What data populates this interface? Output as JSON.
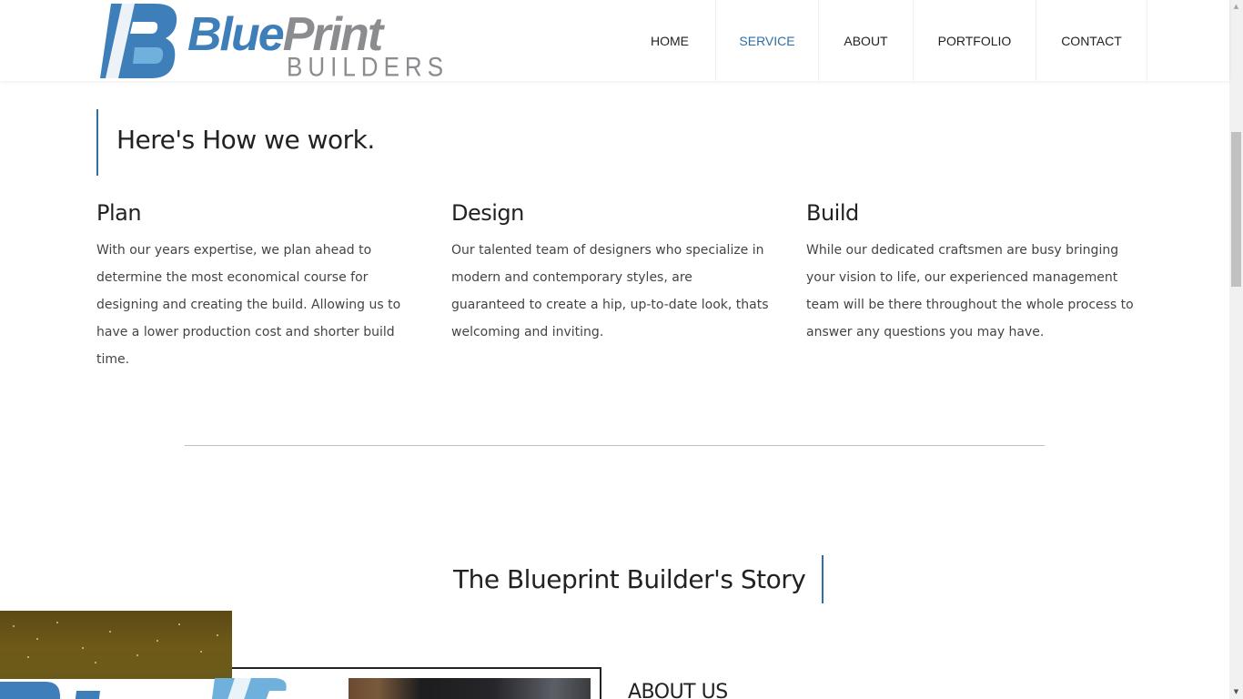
{
  "header": {
    "logo": {
      "word_blue": "Blue",
      "word_grey": "Print",
      "sub": "BUILDERS"
    },
    "nav": [
      {
        "label": "HOME",
        "active": false
      },
      {
        "label": "SERVICE",
        "active": true
      },
      {
        "label": "ABOUT",
        "active": false
      },
      {
        "label": "PORTFOLIO",
        "active": false
      },
      {
        "label": "CONTACT",
        "active": false
      }
    ]
  },
  "how": {
    "heading": "Here's How we work.",
    "columns": [
      {
        "title": "Plan",
        "text": "With our years expertise, we plan ahead to determine the most economical course for designing and creating the build. Allowing us to have a lower production cost and shorter build time."
      },
      {
        "title": "Design",
        "text": "Our talented team of designers who specialize in modern and contemporary styles, are guaranteed to create a hip, up-to-date look, thats welcoming and inviting."
      },
      {
        "title": "Build",
        "text": "While our dedicated craftsmen are busy bringing your vision to life, our experienced management team will be there throughout the whole process to answer any questions you may have."
      }
    ]
  },
  "story": {
    "heading": "The Blueprint Builder's Story"
  },
  "about": {
    "title": "ABOUT US"
  },
  "colors": {
    "brand_blue": "#3f7fb9",
    "logo_grey": "#8a8c8f",
    "accent_line": "#2f6ea5"
  }
}
